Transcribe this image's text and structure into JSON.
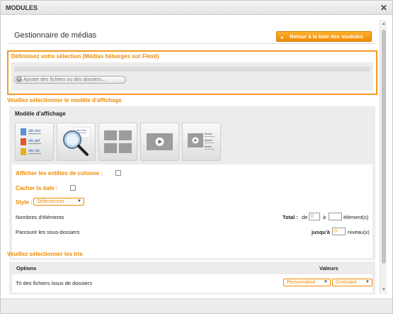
{
  "window": {
    "title": "MODULES",
    "close_glyph": "✕"
  },
  "header": {
    "title": "Gestionnaire de médias",
    "back_button": "Retour à la liste des modules"
  },
  "selection": {
    "title": "Définissez votre sélection (Médias hébergés sur Flexit)",
    "add_button": "Ajouter des fichiers ou des dossiers..."
  },
  "display": {
    "section_title": "Veuillez sélectionner le modèle d'affichage",
    "box_label": "Modèle d'affichage",
    "templates": [
      {
        "icon": "file-list-icon",
        "lines": [
          "abc.doc",
          "abc.ppt",
          "abc.zip"
        ]
      },
      {
        "icon": "magnifier-icon",
        "lines": [
          "abc.doc"
        ]
      },
      {
        "icon": "grid-icon",
        "lines": []
      },
      {
        "icon": "video-icon",
        "lines": []
      },
      {
        "icon": "video-list-icon",
        "lines": [
          "lorem",
          "ipsum",
          "lorem"
        ]
      }
    ],
    "show_headers_label": "Afficher les entêtes de colonne :",
    "show_headers_checked": false,
    "hide_date_label": "Cacher la date :",
    "hide_date_checked": false,
    "style_label": "Style :",
    "style_value": "Sélectionner",
    "elements_label": "Nombres d'éléments",
    "total_label": "Total :",
    "from_label": "de",
    "from_value": "0",
    "to_label": "à",
    "to_value": "",
    "elements_unit": "élément(s)",
    "subfolders_label": "Parcourir les sous-dossiers",
    "up_to_label": "jusqu'à",
    "up_to_value": "0",
    "levels_unit": "niveau(x)"
  },
  "sorts": {
    "section_title": "Veuillez sélectionner les tris",
    "col_options": "Options",
    "col_values": "Valeurs",
    "row_label": "Tri des fichiers issus de dossiers",
    "value_1": "Personnalisé",
    "value_2": "Croissant"
  },
  "colors": {
    "accent": "#f08a00",
    "panel": "#ececec"
  }
}
